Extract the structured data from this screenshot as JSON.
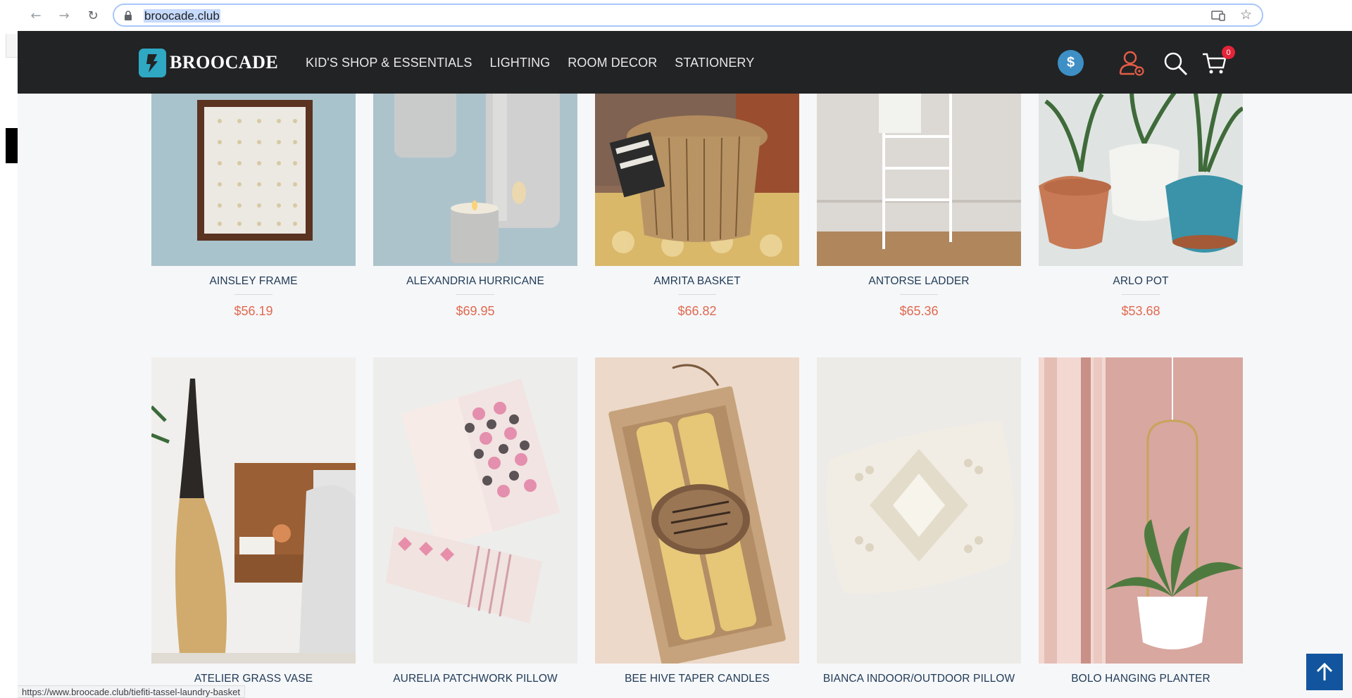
{
  "browser": {
    "url": "broocade.club",
    "status_url": "https://www.broocade.club/tiefiti-tassel-laundry-basket"
  },
  "header": {
    "logo_text": "BROOCADE",
    "menu": [
      {
        "label": "KID'S SHOP & ESSENTIALS"
      },
      {
        "label": "LIGHTING"
      },
      {
        "label": "ROOM DECOR"
      },
      {
        "label": "STATIONERY"
      }
    ],
    "currency_symbol": "$",
    "cart_count": "0"
  },
  "products": [
    {
      "name": "AINSLEY FRAME",
      "price": "$56.19"
    },
    {
      "name": "ALEXANDRIA HURRICANE",
      "price": "$69.95"
    },
    {
      "name": "AMRITA BASKET",
      "price": "$66.82"
    },
    {
      "name": "ANTORSE LADDER",
      "price": "$65.36"
    },
    {
      "name": "ARLO POT",
      "price": "$53.68"
    },
    {
      "name": "ATELIER GRASS VASE"
    },
    {
      "name": "AURELIA PATCHWORK PILLOW"
    },
    {
      "name": "BEE HIVE TAPER CANDLES"
    },
    {
      "name": "BIANCA INDOOR/OUTDOOR PILLOW"
    },
    {
      "name": "BOLO HANGING PLANTER"
    }
  ],
  "colors": {
    "header_bg": "#222324",
    "accent_teal": "#2fa8c4",
    "price": "#e0694f",
    "name": "#1f3a56",
    "back_to_top": "#12559e"
  }
}
